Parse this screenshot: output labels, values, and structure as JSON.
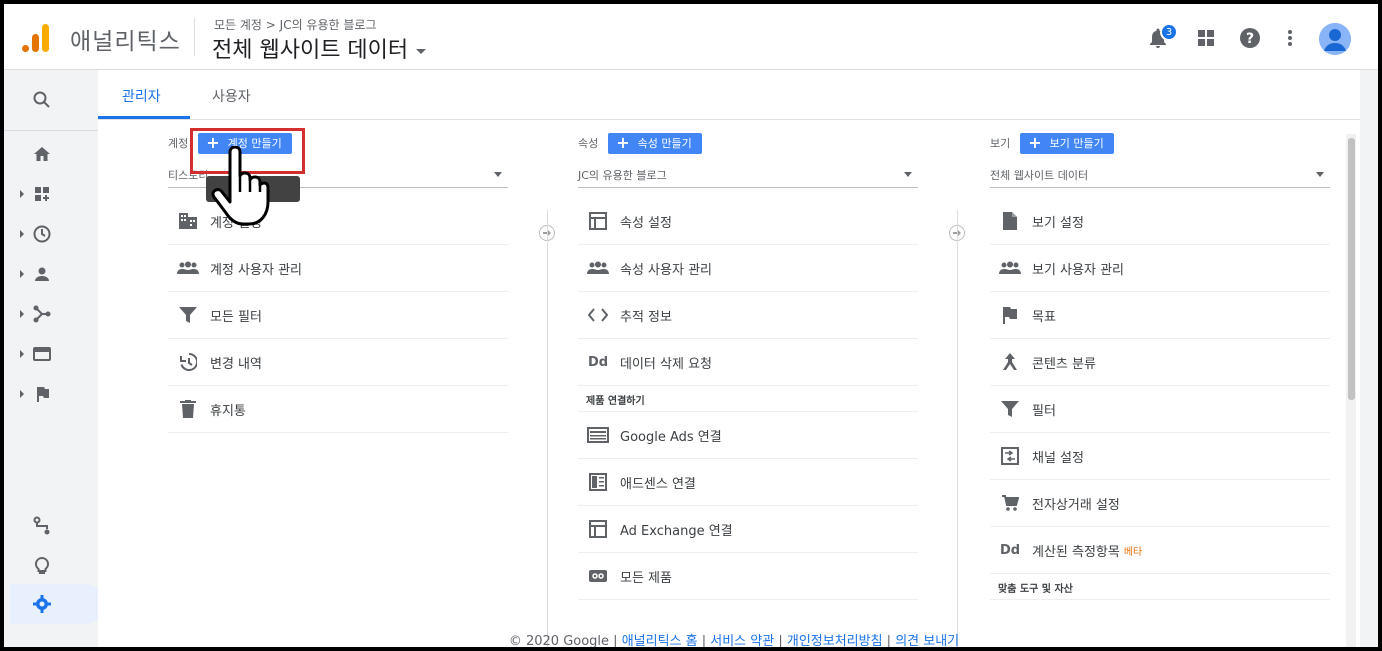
{
  "header": {
    "app_name": "애널리틱스",
    "breadcrumb": "모든 계정 > JC의 유용한 블로그",
    "property_title": "전체 웹사이트 데이터",
    "notification_count": "3"
  },
  "tabs": [
    {
      "label": "관리자"
    },
    {
      "label": "사용자"
    }
  ],
  "account_col": {
    "label": "계정",
    "button": "계정 만들기",
    "selected": "티스토리"
  },
  "property_col": {
    "label": "속성",
    "button": "속성 만들기",
    "selected": "JC의 유용한 블로그"
  },
  "view_col": {
    "label": "보기",
    "button": "보기 만들기",
    "selected": "전체 웹사이트 데이터"
  },
  "account_items": [
    "계정 설정",
    "계정 사용자 관리",
    "모든 필터",
    "변경 내역",
    "휴지통"
  ],
  "property_items": [
    "속성 설정",
    "속성 사용자 관리",
    "추적 정보",
    "데이터 삭제 요청"
  ],
  "property_section": "제품 연결하기",
  "product_items": [
    "Google Ads 연결",
    "애드센스 연결",
    "Ad Exchange 연결",
    "모든 제품"
  ],
  "view_items": [
    "보기 설정",
    "보기 사용자 관리",
    "목표",
    "콘텐츠 분류",
    "필터",
    "채널 설정",
    "전자상거래 설정",
    "계산된 측정항목"
  ],
  "view_beta": "베타",
  "view_section": "맞춤 도구 및 자산",
  "footer": {
    "copyright": "© 2020 Google",
    "links": [
      "애널리틱스 홈",
      "서비스 약관",
      "개인정보처리방침",
      "의견 보내기"
    ]
  },
  "colors": {
    "accent": "#1a73e8",
    "button": "#4285f4",
    "highlight": "#d32f2f"
  }
}
